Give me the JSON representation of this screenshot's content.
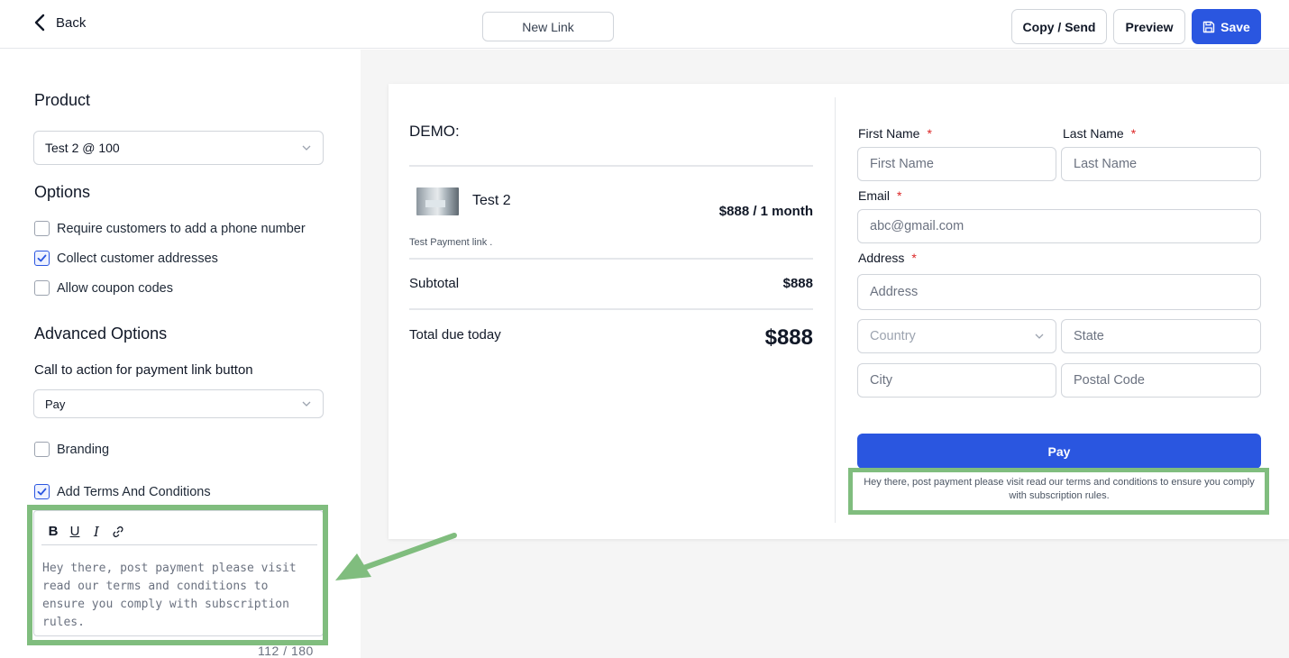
{
  "topbar": {
    "back_label": "Back",
    "link_name": "New Link",
    "copy_send_label": "Copy / Send",
    "preview_label": "Preview",
    "save_label": "Save",
    "accent": "#2a56e0"
  },
  "left": {
    "product_heading": "Product",
    "product_value": "Test 2 @ 100",
    "options_heading": "Options",
    "options": [
      {
        "label": "Require customers to add a phone number",
        "checked": false
      },
      {
        "label": "Collect customer addresses",
        "checked": true
      },
      {
        "label": "Allow coupon codes",
        "checked": false
      }
    ],
    "advanced_heading": "Advanced Options",
    "cta_label": "Call to action for payment link button",
    "cta_value": "Pay",
    "branding_label": "Branding",
    "terms_label": "Add Terms And Conditions",
    "editor_tools": [
      "B",
      "U",
      "I",
      "link-icon"
    ],
    "editor_text": "Hey there, post payment please visit read our terms and conditions to ensure you comply with subscription rules.",
    "counter": "112 / 180"
  },
  "preview": {
    "store": "DEMO:",
    "product_name": "Test 2",
    "product_price": "$888 / 1 month",
    "product_desc": "Test Payment link .",
    "subtotal_label": "Subtotal",
    "subtotal_value": "$888",
    "total_label": "Total due today",
    "total_value": "$888",
    "form": {
      "first_name_label": "First Name",
      "first_name_placeholder": "First Name",
      "last_name_label": "Last Name",
      "last_name_placeholder": "Last Name",
      "email_label": "Email",
      "email_placeholder": "abc@gmail.com",
      "address_label": "Address",
      "address_placeholder": "Address",
      "country_placeholder": "Country",
      "state_placeholder": "State",
      "city_placeholder": "City",
      "postal_placeholder": "Postal Code",
      "required_mark": "*"
    },
    "pay_label": "Pay",
    "terms_text": "Hey there, post payment please visit read our terms and conditions to ensure you comply with subscription rules."
  },
  "annotation_color": "#80bd7e"
}
